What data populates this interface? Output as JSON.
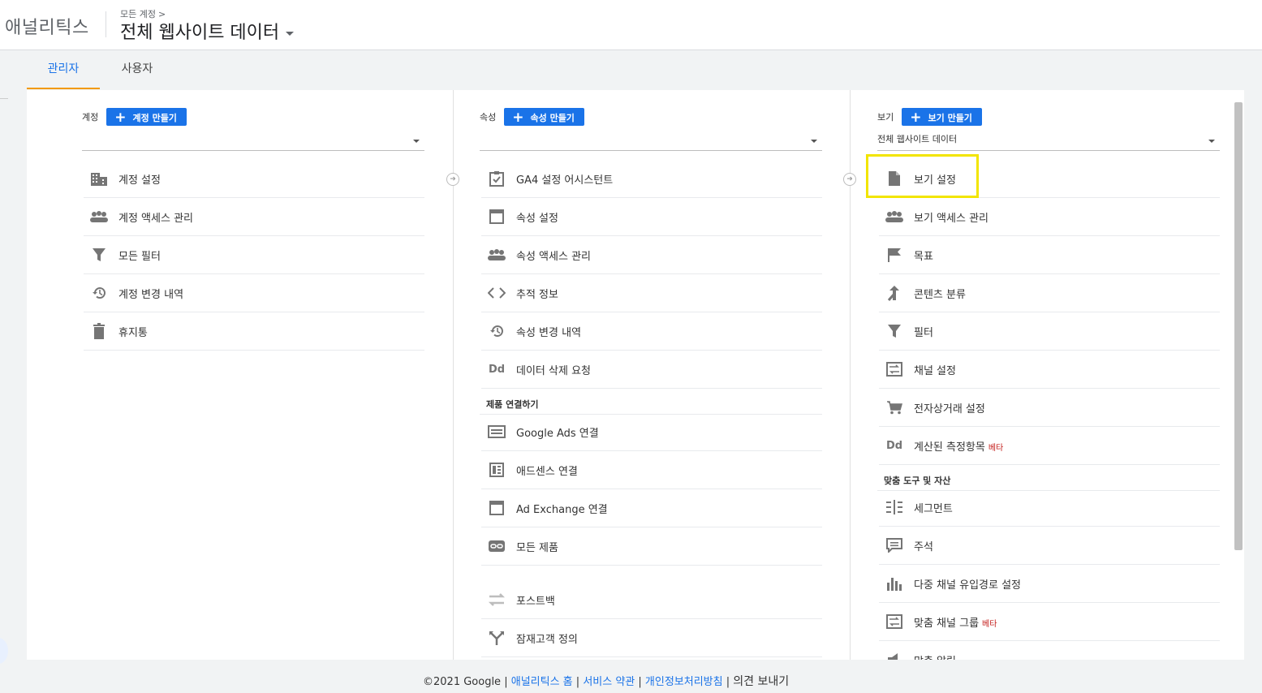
{
  "header": {
    "brand": "애널리틱스",
    "breadcrumb": "모든 계정",
    "view_title": "전체 웹사이트 데이터"
  },
  "tabs": [
    "관리자",
    "사용자"
  ],
  "account_col": {
    "label": "계정",
    "create_label": "계정 만들기",
    "selected": "",
    "items": [
      "계정 설정",
      "계정 액세스 관리",
      "모든 필터",
      "계정 변경 내역",
      "휴지통"
    ]
  },
  "property_col": {
    "label": "속성",
    "create_label": "속성 만들기",
    "selected": "",
    "items": [
      "GA4 설정 어시스턴트",
      "속성 설정",
      "속성 액세스 관리",
      "추적 정보",
      "속성 변경 내역",
      "데이터 삭제 요청"
    ],
    "section": "제품 연결하기",
    "link_items": [
      "Google Ads 연결",
      "애드센스 연결",
      "Ad Exchange 연결",
      "모든 제품"
    ],
    "extra_items": [
      "포스트백",
      "잠재고객 정의"
    ]
  },
  "view_col": {
    "label": "보기",
    "create_label": "보기 만들기",
    "selected": "전체 웹사이트 데이터",
    "items": [
      "보기 설정",
      "보기 액세스 관리",
      "목표",
      "콘텐츠 분류",
      "필터",
      "채널 설정",
      "전자상거래 설정",
      "계산된 측정항목"
    ],
    "beta": "베타",
    "section": "맞춤 도구 및 자산",
    "tool_items": [
      "세그먼트",
      "주석",
      "다중 채널 유입경로 설정",
      "맞춤 채널 그룹",
      "맞춤 알림"
    ]
  },
  "footer": {
    "copyright": "©2021 Google",
    "sep": "|",
    "home": "애널리틱스 홈",
    "terms": "서비스 약관",
    "privacy": "개인정보처리방침",
    "feedback": "의견 보내기"
  },
  "colors": {
    "accent": "#1a73e8",
    "tab_underline": "#f29900",
    "highlight": "#f2e500"
  },
  "icons": [
    "building-icon",
    "people-icon",
    "filter-icon",
    "history-icon",
    "trash-icon",
    "checklist-icon",
    "window-icon",
    "code-icon",
    "dd-icon",
    "ads-icon",
    "adsense-icon",
    "link-icon",
    "postback-icon",
    "audience-icon",
    "document-icon",
    "flag-icon",
    "grouping-icon",
    "channel-icon",
    "cart-icon",
    "segment-icon",
    "comment-icon",
    "bar-chart-icon",
    "alert-icon"
  ]
}
